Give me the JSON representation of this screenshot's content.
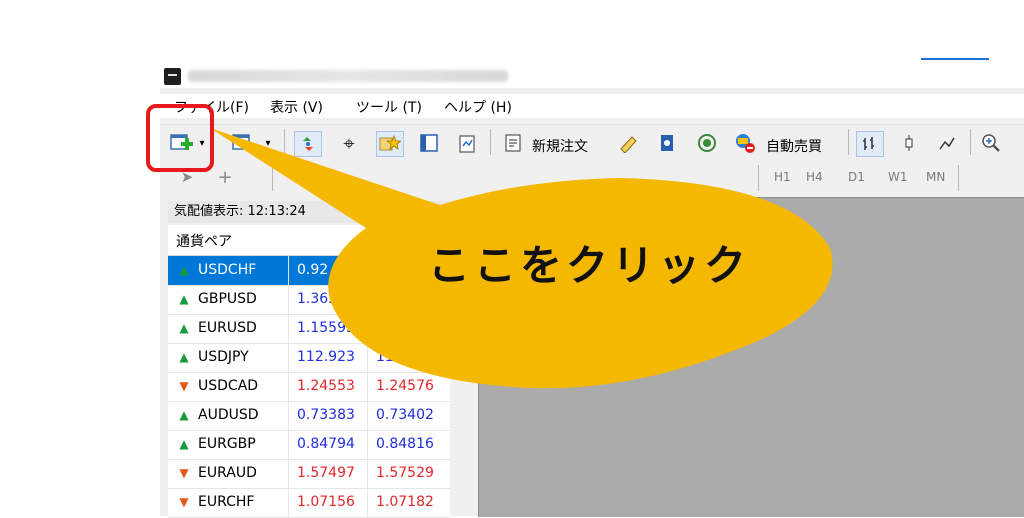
{
  "menu": {
    "file": "ファイル(F)",
    "view": "表示 (V)",
    "tools": "ツール (T)",
    "help": "ヘルプ (H)"
  },
  "toolbar": {
    "new_order_label": "新規注文",
    "auto_trading_label": "自動売買"
  },
  "timeframes": [
    "H1",
    "H4",
    "D1",
    "W1",
    "MN"
  ],
  "market_watch": {
    "header": "気配値表示: 12:13:24",
    "column_symbol": "通貨ペア",
    "rows": [
      {
        "symbol": "USDCHF",
        "bid": "0.92",
        "ask": "",
        "direction": "up",
        "color": "blue",
        "selected": true
      },
      {
        "symbol": "GBPUSD",
        "bid": "1.363",
        "ask": "",
        "direction": "up",
        "color": "blue"
      },
      {
        "symbol": "EURUSD",
        "bid": "1.15595",
        "ask": "",
        "direction": "up",
        "color": "blue"
      },
      {
        "symbol": "USDJPY",
        "bid": "112.923",
        "ask": "112.9",
        "direction": "up",
        "color": "blue"
      },
      {
        "symbol": "USDCAD",
        "bid": "1.24553",
        "ask": "1.24576",
        "direction": "down",
        "color": "red"
      },
      {
        "symbol": "AUDUSD",
        "bid": "0.73383",
        "ask": "0.73402",
        "direction": "up",
        "color": "blue"
      },
      {
        "symbol": "EURGBP",
        "bid": "0.84794",
        "ask": "0.84816",
        "direction": "up",
        "color": "blue"
      },
      {
        "symbol": "EURAUD",
        "bid": "1.57497",
        "ask": "1.57529",
        "direction": "down",
        "color": "red"
      },
      {
        "symbol": "EURCHF",
        "bid": "1.07156",
        "ask": "1.07182",
        "direction": "down",
        "color": "red"
      }
    ]
  },
  "callout": {
    "text": "ここをクリック",
    "fill_color": "#f5b800",
    "highlight_color": "#e8191c"
  }
}
